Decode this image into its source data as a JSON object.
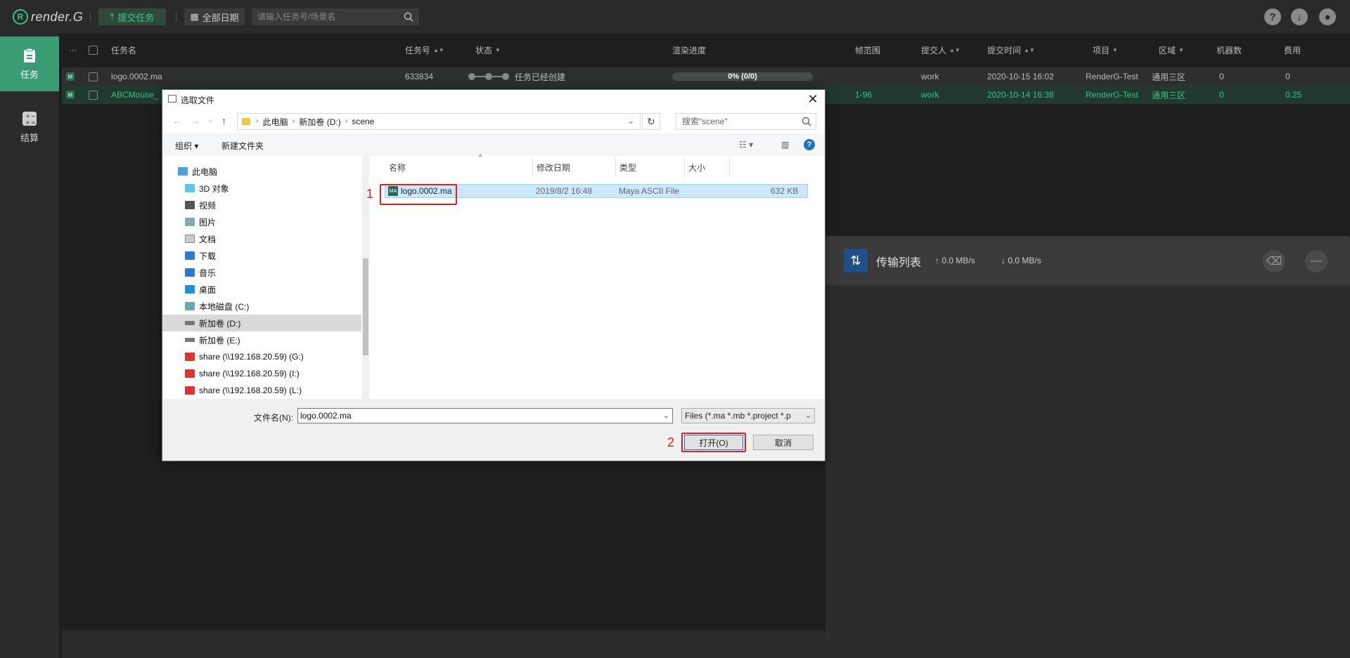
{
  "app": {
    "logo_text": "render.G",
    "submit_label": "提交任务",
    "date_label": "全部日期",
    "search_placeholder": "请输入任务号/场景名"
  },
  "sidebar": {
    "items": [
      {
        "label": "任务",
        "icon": "clipboard-icon"
      },
      {
        "label": "结算",
        "icon": "calculator-icon"
      }
    ]
  },
  "table": {
    "headers": {
      "more": "···",
      "name": "任务名",
      "id": "任务号",
      "status": "状态",
      "progress": "渲染进度",
      "frames": "帧范围",
      "submitter": "提交人",
      "time": "提交时间",
      "project": "项目",
      "zone": "区域",
      "machines": "机器数",
      "cost": "费用"
    },
    "rows": [
      {
        "badge": "M",
        "name": "logo.0002.ma",
        "id": "633834",
        "status": "任务已经创建",
        "progress": "0% (0/0)",
        "progress_fraction": 0,
        "frames": "",
        "submitter": "work",
        "time": "2020-10-15 16:02",
        "project": "RenderG-Test",
        "zone": "通用三区",
        "machines": "0",
        "cost": "0"
      },
      {
        "badge": "M",
        "name": "ABCMouse_",
        "id": "",
        "status": "",
        "progress": "",
        "frames": "1-96",
        "submitter": "work",
        "time": "2020-10-14 16:38",
        "project": "RenderG-Test",
        "zone": "通用三区",
        "machines": "0",
        "cost": "0.25"
      }
    ]
  },
  "transfer": {
    "title": "传输列表",
    "upload_speed": "0.0 MB/s",
    "download_speed": "0.0 MB/s"
  },
  "dialog": {
    "title": "选取文件",
    "breadcrumb": [
      "此电脑",
      "新加卷 (D:)",
      "scene"
    ],
    "search_placeholder": "搜索\"scene\"",
    "toolbar": {
      "organize": "组织",
      "new_folder": "新建文件夹"
    },
    "tree": [
      {
        "label": "此电脑",
        "icon": "computer-icon",
        "level": 0
      },
      {
        "label": "3D 对象",
        "icon": "cube-icon",
        "level": 1
      },
      {
        "label": "视频",
        "icon": "video-icon",
        "level": 1
      },
      {
        "label": "图片",
        "icon": "picture-icon",
        "level": 1
      },
      {
        "label": "文档",
        "icon": "document-icon",
        "level": 1
      },
      {
        "label": "下载",
        "icon": "download-icon",
        "level": 1
      },
      {
        "label": "音乐",
        "icon": "music-icon",
        "level": 1
      },
      {
        "label": "桌面",
        "icon": "desktop-icon",
        "level": 1
      },
      {
        "label": "本地磁盘 (C:)",
        "icon": "drive-icon",
        "level": 1
      },
      {
        "label": "新加卷 (D:)",
        "icon": "drive-icon",
        "level": 1,
        "selected": true
      },
      {
        "label": "新加卷 (E:)",
        "icon": "drive-icon",
        "level": 1
      },
      {
        "label": "share (\\\\192.168.20.59) (G:)",
        "icon": "network-drive-icon",
        "level": 1
      },
      {
        "label": "share (\\\\192.168.20.59) (I:)",
        "icon": "network-drive-icon",
        "level": 1
      },
      {
        "label": "share (\\\\192.168.20.59) (L:)",
        "icon": "network-drive-icon",
        "level": 1
      }
    ],
    "columns": {
      "name": "名称",
      "modified": "修改日期",
      "type": "类型",
      "size": "大小"
    },
    "file": {
      "name": "logo.0002.ma",
      "modified": "2019/8/2 16:48",
      "type": "Maya ASCII File",
      "size": "632 KB"
    },
    "filename_label": "文件名(N):",
    "filename_value": "logo.0002.ma",
    "filetype": "Files (*.ma *.mb *.project *.p",
    "open_label": "打开(O)",
    "cancel_label": "取消",
    "annotations": {
      "step1": "1",
      "step2": "2"
    }
  }
}
